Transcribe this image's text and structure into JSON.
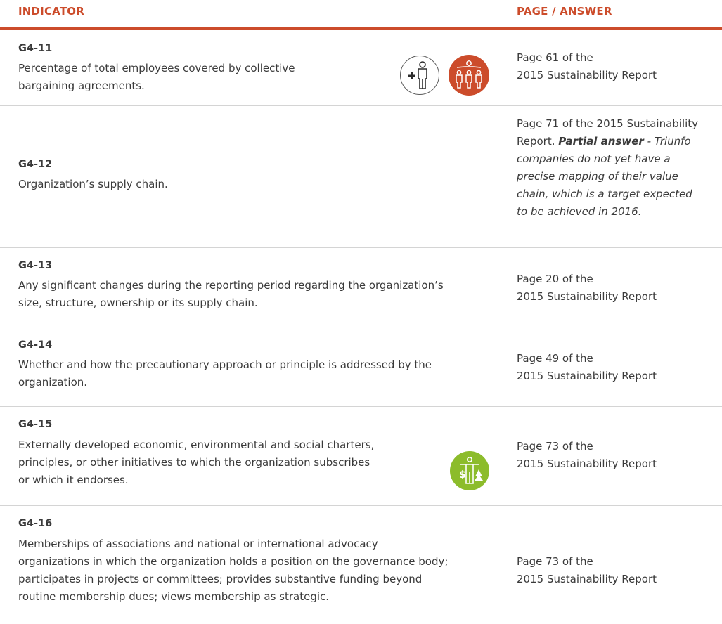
{
  "header": {
    "indicator_label": "INDICATOR",
    "answer_label": "PAGE / ANSWER"
  },
  "rows": [
    {
      "code": "G4-11",
      "desc_lines": [
        "Percentage of total employees covered by collective",
        "bargaining agreements."
      ],
      "answer_lines": [
        "Page 61 of the",
        "2015 Sustainability Report"
      ]
    },
    {
      "code": "G4-12",
      "desc_lines": [
        "Organization’s supply chain."
      ],
      "answer_lines": [
        "Page 71 of the 2015 Sustainability",
        "Report."
      ],
      "answer_partial_label": "Partial answer",
      "answer_partial_text": [
        " - Triunfo",
        "companies do not yet have a",
        "precise mapping of their value",
        "chain, which is a target expected",
        "to be achieved in 2016."
      ]
    },
    {
      "code": "G4-13",
      "desc_lines": [
        "Any significant changes during the reporting period regarding the organization’s",
        "size, structure, ownership or its supply chain."
      ],
      "answer_lines": [
        "Page 20 of the",
        "2015 Sustainability Report"
      ]
    },
    {
      "code": "G4-14",
      "desc_lines": [
        "Whether and how the precautionary approach or principle is addressed by the",
        "organization."
      ],
      "answer_lines": [
        "Page 49 of the",
        "2015 Sustainability Report"
      ]
    },
    {
      "code": "G4-15",
      "desc_lines": [
        "Externally developed economic, environmental and social charters,",
        "principles, or other initiatives to which the organization subscribes",
        "or which it endorses."
      ],
      "answer_lines": [
        "Page 73 of the",
        "2015 Sustainability Report"
      ]
    },
    {
      "code": "G4-16",
      "desc_lines": [
        "Memberships of associations and national or international advocacy",
        "organizations in which the organization holds a position on the governance body;",
        "participates in projects or committees; provides substantive funding beyond",
        "routine membership dues; views membership as strategic."
      ],
      "answer_lines": [
        "Page 73 of the",
        "2015 Sustainability Report"
      ]
    }
  ],
  "icons": {
    "row1": [
      "person-plus-icon",
      "employees-group-icon"
    ],
    "row5": [
      "economic-environment-balance-icon"
    ]
  },
  "colors": {
    "accent": "#cc4c2b",
    "green": "#8cbc2b",
    "text": "#3a3a3a",
    "divider": "#d4d4d4"
  }
}
